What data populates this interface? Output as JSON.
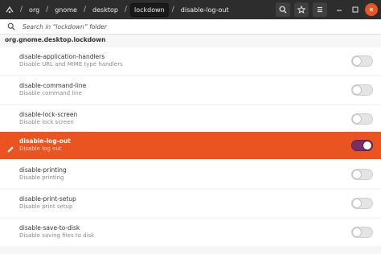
{
  "breadcrumbs": [
    "org",
    "gnome",
    "desktop",
    "lockdown",
    "disable-log-out"
  ],
  "active_crumb_index": 3,
  "search": {
    "placeholder": "Search in “lockdown” folder"
  },
  "path_title": "org.gnome.desktop.lockdown",
  "keys": [
    {
      "name": "disable-application-handlers",
      "description": "Disable URL and MIME type handlers",
      "enabled": false,
      "selected": false
    },
    {
      "name": "disable-command-line",
      "description": "Disable command line",
      "enabled": false,
      "selected": false
    },
    {
      "name": "disable-lock-screen",
      "description": "Disable lock screen",
      "enabled": false,
      "selected": false
    },
    {
      "name": "disable-log-out",
      "description": "Disable log out",
      "enabled": true,
      "selected": true
    },
    {
      "name": "disable-printing",
      "description": "Disable printing",
      "enabled": false,
      "selected": false
    },
    {
      "name": "disable-print-setup",
      "description": "Disable print setup",
      "enabled": false,
      "selected": false
    },
    {
      "name": "disable-save-to-disk",
      "description": "Disable saving files to disk",
      "enabled": false,
      "selected": false
    }
  ],
  "icons": {
    "app": "dconf-editor-icon",
    "search": "search-icon",
    "bookmark": "star-icon",
    "menu": "hamburger-menu-icon",
    "minimize": "minimize-icon",
    "maximize": "maximize-icon",
    "close": "close-icon",
    "edit": "pencil-icon"
  },
  "colors": {
    "accent": "#e95420",
    "toggle_on": "#772f67",
    "headerbar": "#2d2d2d"
  }
}
